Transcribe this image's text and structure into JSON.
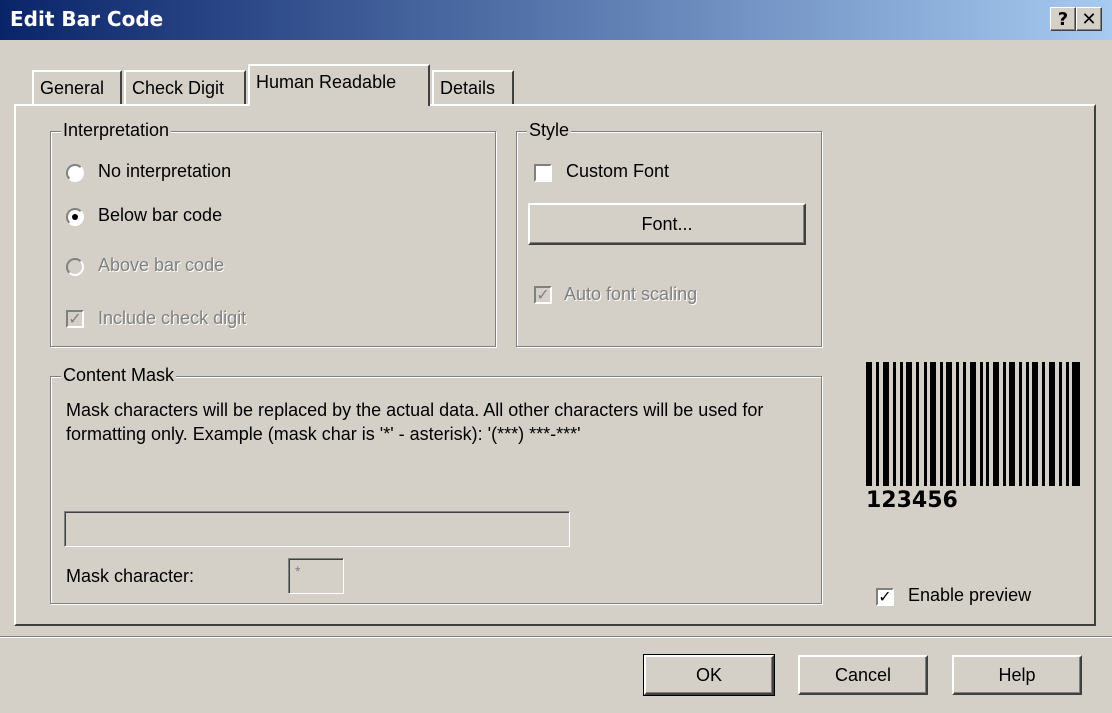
{
  "window": {
    "title": "Edit Bar Code",
    "help_label": "?",
    "close_label": "✕"
  },
  "tabs": [
    {
      "label": "General",
      "active": false
    },
    {
      "label": "Check Digit",
      "active": false
    },
    {
      "label": "Human Readable",
      "active": true
    },
    {
      "label": "Details",
      "active": false
    }
  ],
  "interpretation": {
    "legend": "Interpretation",
    "options": [
      {
        "label": "No interpretation",
        "selected": false,
        "enabled": true
      },
      {
        "label": "Below bar code",
        "selected": true,
        "enabled": true
      },
      {
        "label": "Above bar code",
        "selected": false,
        "enabled": false
      }
    ],
    "include_check_digit": {
      "label": "Include check digit",
      "checked": true,
      "enabled": false
    }
  },
  "style": {
    "legend": "Style",
    "custom_font": {
      "label": "Custom Font",
      "checked": false
    },
    "font_button": "Font...",
    "auto_font_scaling": {
      "label": "Auto font scaling",
      "checked": true,
      "enabled": false
    }
  },
  "content_mask": {
    "legend": "Content Mask",
    "description": "Mask characters will be replaced by the actual data. All other characters will be used for formatting only. Example (mask char is '*' - asterisk): '(***) ***-***'",
    "mask_value": "",
    "mask_character_label": "Mask character:",
    "mask_character_value": "*"
  },
  "preview": {
    "barcode_text": "123456",
    "enable_preview": {
      "label": "Enable preview",
      "checked": true
    }
  },
  "buttons": {
    "ok": "OK",
    "cancel": "Cancel",
    "help": "Help"
  }
}
